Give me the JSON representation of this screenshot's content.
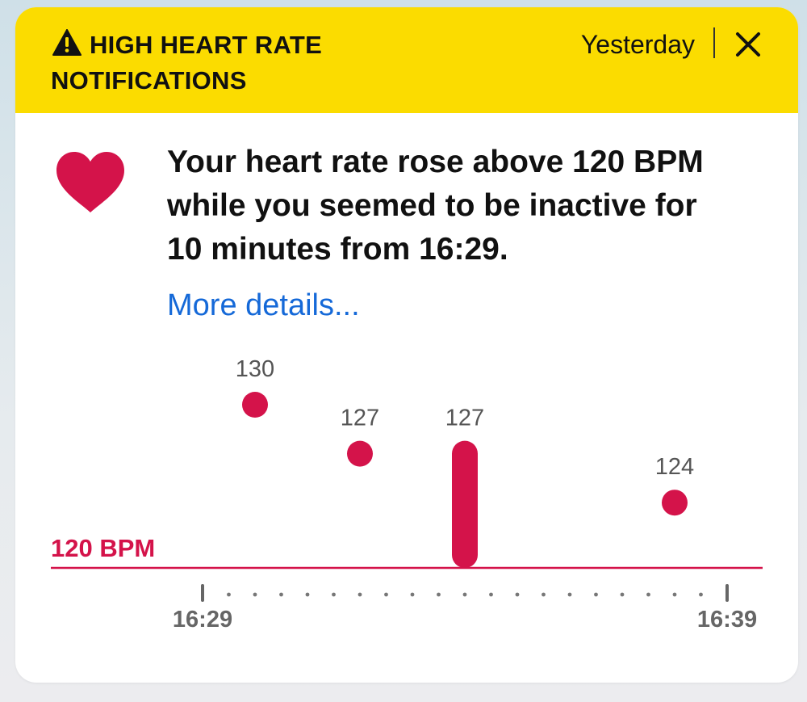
{
  "notification": {
    "title_line1": "HIGH HEART RATE",
    "title_line2": "NOTIFICATIONS",
    "time": "Yesterday",
    "message_line1": "Your heart rate rose above 120 BPM",
    "message_line2": "while you seemed to be inactive for",
    "message_line3": "10 minutes from 16:29.",
    "more_details": "More details...",
    "header_color": "#fbdc00",
    "accent_color": "#d4134a",
    "link_color": "#1569d8",
    "icons": [
      "warning-icon",
      "close-icon",
      "heart-icon"
    ]
  },
  "chart_data": {
    "type": "scatter",
    "threshold": {
      "label": "120 BPM",
      "value": 120
    },
    "x_start_label": "16:29",
    "x_end_label": "16:39",
    "points": [
      {
        "time": "16:30",
        "value": 130,
        "label": "130",
        "kind": "dot"
      },
      {
        "time": "16:32",
        "value": 127,
        "label": "127",
        "kind": "dot"
      },
      {
        "time": "16:34",
        "value": 127,
        "min": 120,
        "label": "127",
        "kind": "range"
      },
      {
        "time": "16:38",
        "value": 124,
        "label": "124",
        "kind": "dot"
      }
    ]
  }
}
